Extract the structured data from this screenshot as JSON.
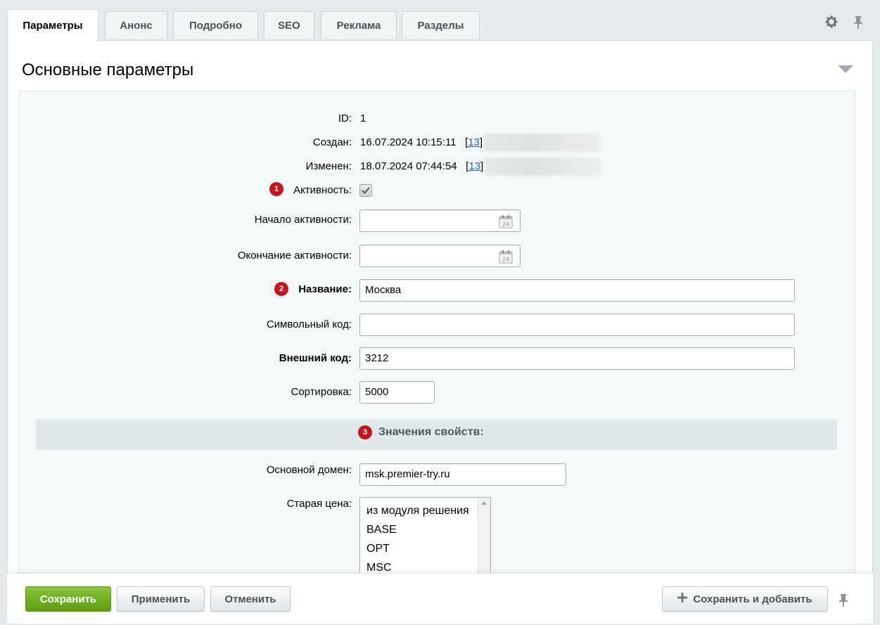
{
  "tabs": [
    "Параметры",
    "Анонс",
    "Подробно",
    "SEO",
    "Реклама",
    "Разделы"
  ],
  "active_tab": "Параметры",
  "icons": {
    "settings": "gear-icon",
    "pin": "pin-icon",
    "calendar": "calendar-icon",
    "collapse": "chevron-down-icon"
  },
  "section": {
    "title": "Основные параметры"
  },
  "fields": {
    "id_label": "ID:",
    "id_value": "1",
    "created_label": "Создан:",
    "created_value": "16.07.2024 10:15:11",
    "created_user_link": "13",
    "modified_label": "Изменен:",
    "modified_value": "18.07.2024 07:44:54",
    "modified_user_link": "13",
    "active_label": "Активность:",
    "active_checked": true,
    "active_from_label": "Начало активности:",
    "active_from_value": "",
    "active_to_label": "Окончание активности:",
    "active_to_value": "",
    "calendar_day": "24",
    "name_label": "Название:",
    "name_value": "Москва",
    "code_label": "Символьный код:",
    "code_value": "",
    "xml_id_label": "Внешний код:",
    "xml_id_value": "3212",
    "sort_label": "Сортировка:",
    "sort_value": "5000"
  },
  "properties": {
    "title": "Значения свойств:",
    "main_domain_label": "Основной домен:",
    "main_domain_value": "msk.premier-try.ru",
    "old_price_label": "Старая цена:",
    "old_price_options": [
      "из модуля решения",
      "BASE",
      "OPT",
      "MSC"
    ]
  },
  "badges": [
    "1",
    "2",
    "3"
  ],
  "footer": {
    "save": "Сохранить",
    "apply": "Применить",
    "cancel": "Отменить",
    "save_and_add": "Сохранить и добавить"
  },
  "colors": {
    "primary": "#6aab1c",
    "badge": "#c3151a",
    "link": "#2067b0"
  }
}
